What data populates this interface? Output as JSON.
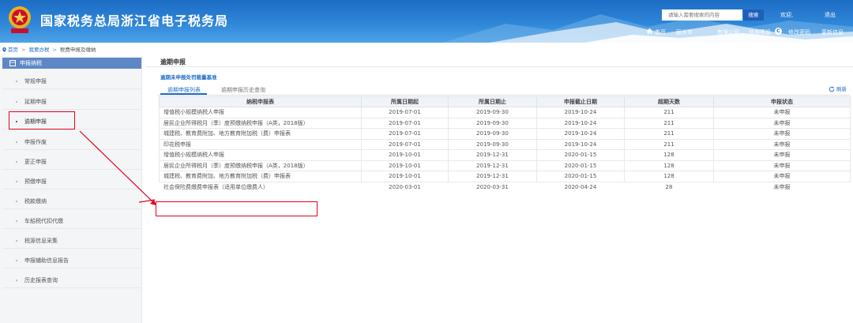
{
  "header": {
    "site_title": "国家税务总局浙江省电子税务局",
    "search_placeholder": "请输入需要搜索的内容",
    "search_button": "搜索",
    "welcome": "欢迎,",
    "logout": "退出",
    "nav_home": "首页",
    "nav_city": "丽水市",
    "nav_company": "有限公司",
    "nav_level": "信用等级",
    "level_badge": "C",
    "nav_change_password": "修改密码",
    "nav_update_info": "更新信息"
  },
  "breadcrumb": {
    "home": "首页",
    "tax": "我要办税",
    "current": "税费申报及缴纳"
  },
  "sidebar": {
    "heading": "申报纳税",
    "items": [
      {
        "label": "常规申报"
      },
      {
        "label": "延期申报"
      },
      {
        "label": "逾期申报"
      },
      {
        "label": "申报作废"
      },
      {
        "label": "更正申报"
      },
      {
        "label": "预缴申报"
      },
      {
        "label": "税款缴纳"
      },
      {
        "label": "车船税代扣代缴"
      },
      {
        "label": "税源信息采集"
      },
      {
        "label": "申报辅助信息报告"
      },
      {
        "label": "历史报表查询"
      }
    ],
    "active_index": 2
  },
  "main": {
    "title": "逾期申报",
    "penalty_link": "逾期未申报处罚裁量基准",
    "tabs": [
      {
        "label": "逾期申报列表"
      },
      {
        "label": "逾期申报历史查询"
      }
    ],
    "refresh": "刷新"
  },
  "table": {
    "headers": [
      "纳税申报表",
      "所属日期起",
      "所属日期止",
      "申报截止日期",
      "超期天数",
      "申报状态"
    ],
    "rows": [
      [
        "增值税小规模纳税人申报",
        "2019-07-01",
        "2019-09-30",
        "2019-10-24",
        "211",
        "未申报"
      ],
      [
        "居民企业所得税月（季）度预缴纳税申报（A类，2018版）",
        "2019-07-01",
        "2019-09-30",
        "2019-10-24",
        "211",
        "未申报"
      ],
      [
        "城建税、教育费附加、地方教育附加税（费）申报表",
        "2019-07-01",
        "2019-09-30",
        "2019-10-24",
        "211",
        "未申报"
      ],
      [
        "印花税申报",
        "2019-07-01",
        "2019-09-30",
        "2019-10-24",
        "211",
        "未申报"
      ],
      [
        "增值税小规模纳税人申报",
        "2019-10-01",
        "2019-12-31",
        "2020-01-15",
        "128",
        "未申报"
      ],
      [
        "居民企业所得税月（季）度预缴纳税申报（A类，2018版）",
        "2019-10-01",
        "2019-12-31",
        "2020-01-15",
        "128",
        "未申报"
      ],
      [
        "城建税、教育费附加、地方教育附加税（费）申报表",
        "2019-10-01",
        "2019-12-31",
        "2020-01-15",
        "128",
        "未申报"
      ],
      [
        "社会保险费缴费申报表（适用单位缴费人）",
        "2020-03-01",
        "2020-03-31",
        "2020-04-24",
        "28",
        "未申报"
      ]
    ]
  },
  "colors": {
    "header_blue": "#2f86d8",
    "link_blue": "#1f6fc6",
    "annotation_red": "#e3001b",
    "sidebar_head": "#5e87c6"
  }
}
